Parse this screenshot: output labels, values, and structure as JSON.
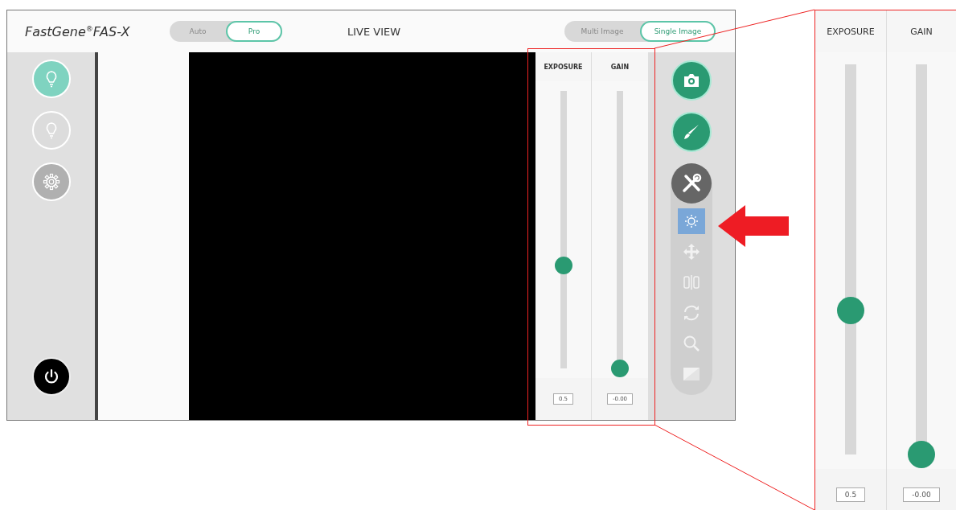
{
  "header": {
    "logo": "FastGene$^{®}$FAS-X",
    "mode_toggle": [
      {
        "label": "Auto",
        "selected": false
      },
      {
        "label": "Pro",
        "selected": true
      }
    ],
    "title": "LIVE VIEW",
    "image_toggle": [
      {
        "label": "Multi Image",
        "selected": false
      },
      {
        "label": "Single Image",
        "selected": true
      }
    ]
  },
  "left_sidebar": {
    "buttons": [
      {
        "kind": "light",
        "selected": true
      },
      {
        "kind": "light",
        "selected": false
      },
      {
        "kind": "settings"
      }
    ],
    "power": {
      "kind": "power"
    }
  },
  "sliders": [
    {
      "label": "EXPOSURE",
      "level": 0.37,
      "value": "0.5"
    },
    {
      "label": "GAIN",
      "level": 0,
      "value": "-0.00"
    }
  ],
  "tools": {
    "buttons": [
      {
        "kind": "camera"
      },
      {
        "kind": "brush"
      }
    ],
    "adjust": [
      {
        "kind": "brightness",
        "selected": true
      },
      {
        "kind": "move",
        "selected": false
      },
      {
        "kind": "split",
        "selected": false
      },
      {
        "kind": "rotate",
        "selected": false
      },
      {
        "kind": "zoom",
        "selected": false
      },
      {
        "kind": "contrast",
        "selected": false
      }
    ]
  },
  "callout": {
    "sliders": [
      {
        "label": "EXPOSURE",
        "level": 0.37,
        "value": "0.5"
      },
      {
        "label": "GAIN",
        "level": 0,
        "value": "-0.00"
      }
    ]
  }
}
